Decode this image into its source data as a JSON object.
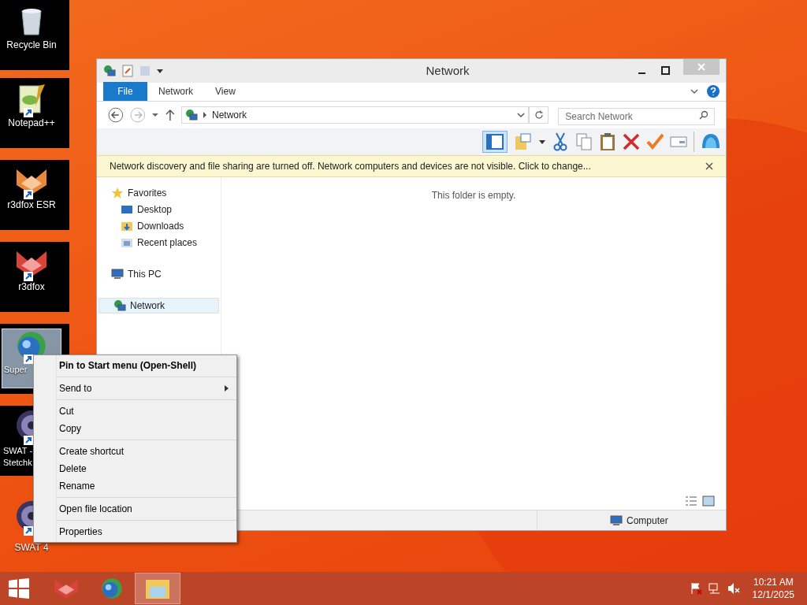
{
  "desktop_icons": [
    {
      "lines": [
        "Recycle Bin"
      ],
      "framed": true,
      "selected": false
    },
    {
      "lines": [
        "Notepad++"
      ],
      "framed": true,
      "selected": false
    },
    {
      "lines": [
        "r3dfox ESR"
      ],
      "framed": true,
      "selected": false
    },
    {
      "lines": [
        "r3dfox"
      ],
      "framed": true,
      "selected": false
    },
    {
      "lines": [
        "Super"
      ],
      "framed": true,
      "selected": true
    },
    {
      "lines": [
        "SWAT -",
        "Stetchk"
      ],
      "framed": true,
      "selected": false
    },
    {
      "lines": [
        "SWAT 4"
      ],
      "framed": false,
      "selected": false
    }
  ],
  "window": {
    "title": "Network",
    "ribbon_tabs": [
      {
        "label": "File",
        "kind": "file",
        "selected": false
      },
      {
        "label": "Network",
        "kind": "tab",
        "selected": false
      },
      {
        "label": "View",
        "kind": "tab",
        "selected": false
      }
    ],
    "address": {
      "path": "Network"
    },
    "search": {
      "placeholder": "Search Network"
    },
    "infobar": {
      "text": "Network discovery and file sharing are turned off. Network computers and devices are not visible. Click to change..."
    },
    "nav_groups": [
      {
        "label": "Favorites",
        "selected": false,
        "children": [
          {
            "label": "Desktop",
            "selected": false
          },
          {
            "label": "Downloads",
            "selected": false
          },
          {
            "label": "Recent places",
            "selected": false
          }
        ]
      },
      {
        "label": "This PC",
        "selected": false
      },
      {
        "label": "Network",
        "selected": true
      }
    ],
    "empty_text": "This folder is empty.",
    "status_bar": {
      "item": "Computer"
    }
  },
  "context_menu": [
    {
      "label": "Pin to Start menu (Open-Shell)",
      "bold": true,
      "submenu": false,
      "separator_before": false
    },
    {
      "label": "Send to",
      "bold": false,
      "submenu": true,
      "separator_before": true
    },
    {
      "label": "Cut",
      "bold": false,
      "submenu": false,
      "separator_before": true
    },
    {
      "label": "Copy",
      "bold": false,
      "submenu": false,
      "separator_before": false
    },
    {
      "label": "Create shortcut",
      "bold": false,
      "submenu": false,
      "separator_before": true
    },
    {
      "label": "Delete",
      "bold": false,
      "submenu": false,
      "separator_before": false
    },
    {
      "label": "Rename",
      "bold": false,
      "submenu": false,
      "separator_before": false
    },
    {
      "label": "Open file location",
      "bold": false,
      "submenu": false,
      "separator_before": true
    },
    {
      "label": "Properties",
      "bold": false,
      "submenu": false,
      "separator_before": true
    }
  ],
  "taskbar": {
    "apps": [
      {
        "selected": false
      },
      {
        "selected": false
      },
      {
        "selected": true
      }
    ],
    "time": "10:21 AM",
    "date": "12/1/2025"
  }
}
